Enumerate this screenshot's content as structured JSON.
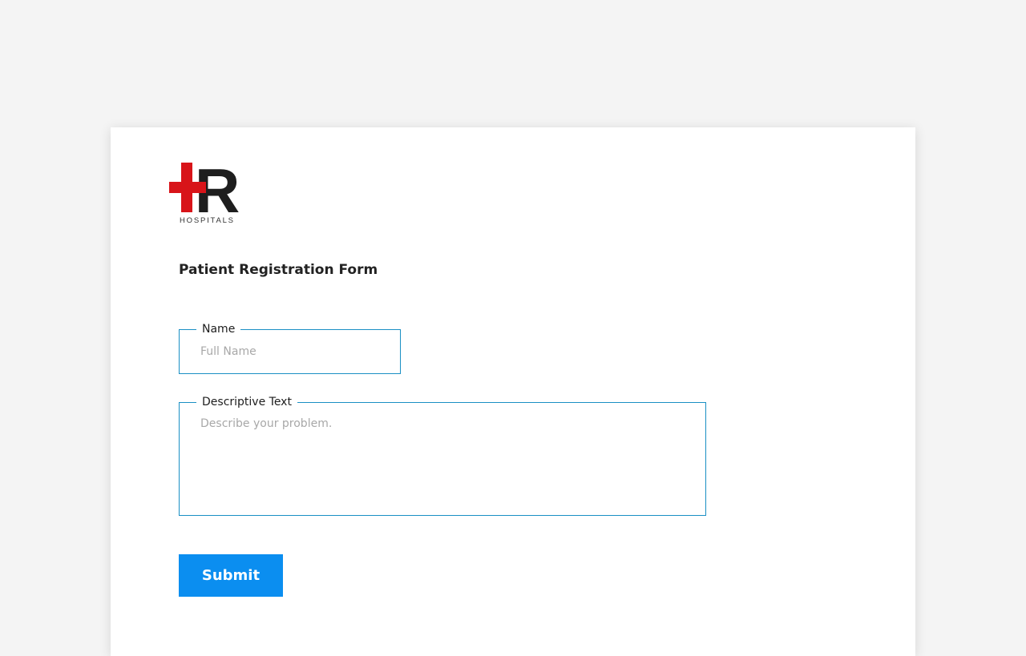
{
  "logo": {
    "letter": "R",
    "subtext": "HOSPITALS",
    "cross_color": "#d81419",
    "letter_color": "#1e1e1e"
  },
  "form": {
    "title": "Patient Registration Form",
    "name_field": {
      "label": "Name",
      "placeholder": "Full Name",
      "value": ""
    },
    "description_field": {
      "label": "Descriptive Text",
      "placeholder": "Describe your problem.",
      "value": ""
    },
    "submit_label": "Submit"
  },
  "colors": {
    "field_border": "#1a8fc4",
    "submit_background": "#0b8ef0",
    "page_background": "#f4f4f4"
  }
}
